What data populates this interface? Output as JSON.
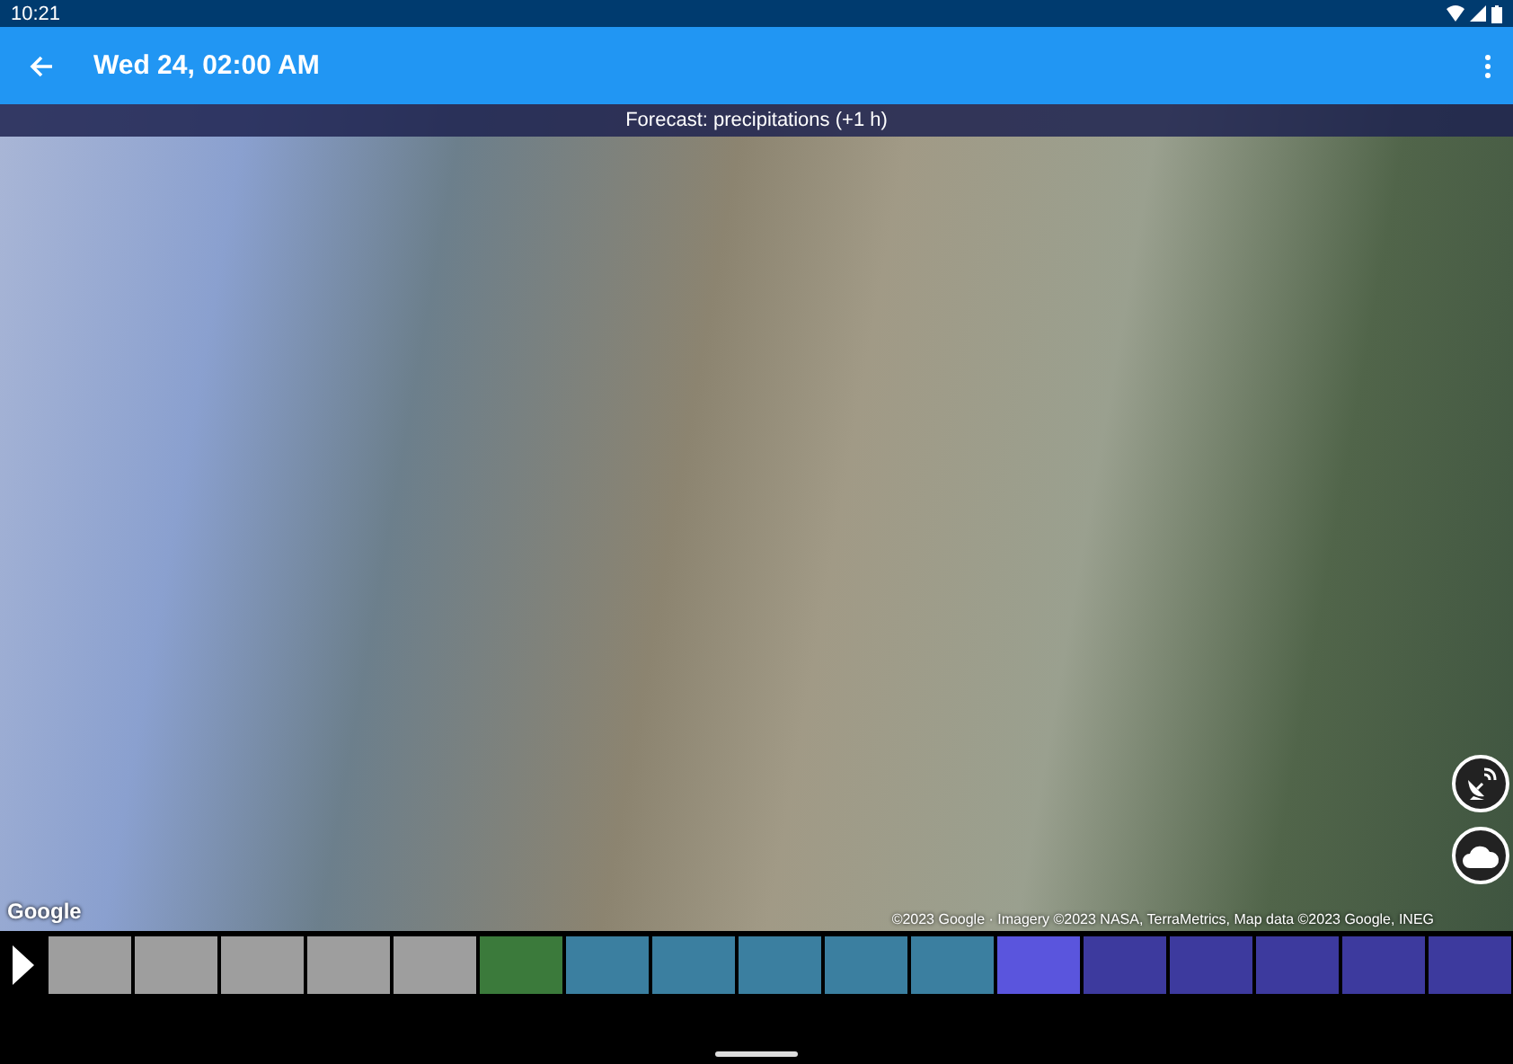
{
  "status_bar": {
    "time": "10:21"
  },
  "app_bar": {
    "title": "Wed 24, 02:00 AM"
  },
  "forecast_banner": {
    "text": "Forecast: precipitations (+1 h)"
  },
  "map": {
    "logo": "Google",
    "attribution": "©2023 Google · Imagery ©2023 NASA, TerraMetrics, Map data ©2023 Google, INEG"
  },
  "timeline": {
    "playing": false,
    "segments": [
      {
        "color": "#9e9e9e"
      },
      {
        "color": "#9e9e9e"
      },
      {
        "color": "#9e9e9e"
      },
      {
        "color": "#9e9e9e"
      },
      {
        "color": "#9e9e9e"
      },
      {
        "color": "#3b7a3b"
      },
      {
        "color": "#3b7fa0"
      },
      {
        "color": "#3b7fa0"
      },
      {
        "color": "#3b7fa0"
      },
      {
        "color": "#3b7fa0"
      },
      {
        "color": "#3b7fa0"
      },
      {
        "color": "#5a55dd"
      },
      {
        "color": "#3d3a9e"
      },
      {
        "color": "#3d3a9e"
      },
      {
        "color": "#3d3a9e"
      },
      {
        "color": "#3d3a9e"
      },
      {
        "color": "#3d3a9e"
      }
    ]
  }
}
